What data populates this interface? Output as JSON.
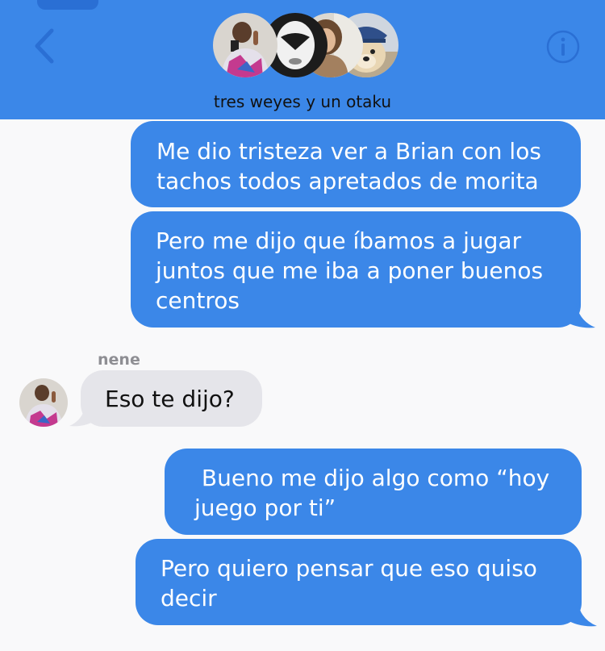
{
  "header": {
    "group_name": "tres weyes y un otaku",
    "back_icon": "chevron-left-icon",
    "info_icon": "info-circle-icon",
    "accent_color": "#3b87e8"
  },
  "participants": [
    {
      "avatar": "participant-avatar-1"
    },
    {
      "avatar": "participant-avatar-2"
    },
    {
      "avatar": "participant-avatar-3"
    },
    {
      "avatar": "participant-avatar-4"
    }
  ],
  "messages": [
    {
      "direction": "outgoing",
      "lines": [
        "Me dio tristeza ver a Brian con los",
        "tachos todos apretados de morita"
      ]
    },
    {
      "direction": "outgoing",
      "lines": [
        "Pero me dijo que íbamos a jugar",
        "juntos que me iba a poner buenos",
        "centros"
      ]
    },
    {
      "direction": "incoming",
      "sender": "nene",
      "lines": [
        "Eso te dijo?"
      ]
    },
    {
      "direction": "outgoing",
      "lines": [
        " Bueno me dijo algo como “hoy",
        "juego por ti”"
      ]
    },
    {
      "direction": "outgoing",
      "lines": [
        "Pero quiero pensar que eso quiso",
        "decir"
      ]
    }
  ],
  "colors": {
    "outgoing_bubble": "#3b87e8",
    "incoming_bubble": "#e5e5ea",
    "background": "#f9f9fa"
  }
}
